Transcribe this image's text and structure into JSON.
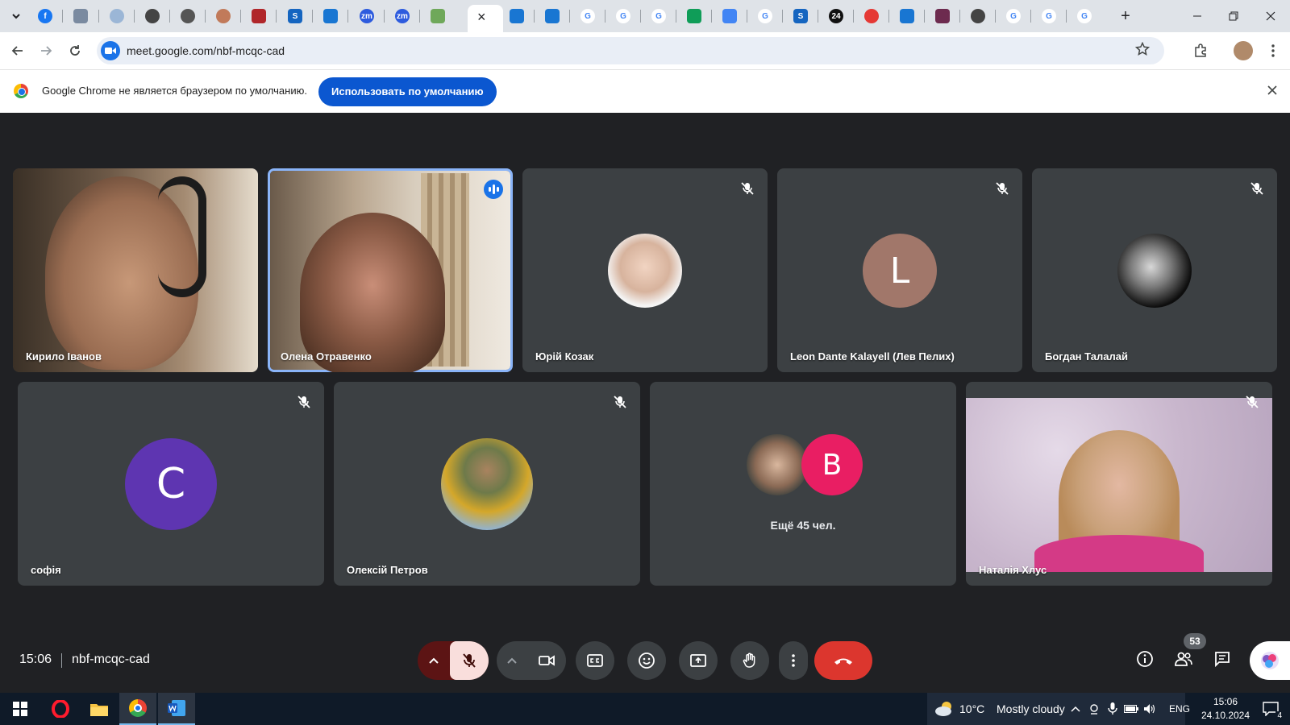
{
  "browser": {
    "url": "meet.google.com/nbf-mcqc-cad",
    "tab_close_glyph": "×",
    "new_tab_glyph": "+"
  },
  "infobar": {
    "message": "Google Chrome не является браузером по умолчанию.",
    "button_label": "Использовать по умолчанию"
  },
  "participants": [
    {
      "name": "Кирило Іванов",
      "type": "video",
      "muted": false
    },
    {
      "name": "Олена Отравенко",
      "type": "video",
      "speaking": true
    },
    {
      "name": "Юрій Козак",
      "type": "photo",
      "muted": true
    },
    {
      "name": "Leon Dante Kalayell (Лев Пелих)",
      "type": "initial",
      "initial": "L",
      "color": "#a1776a",
      "muted": true
    },
    {
      "name": "Богдан Талалай",
      "type": "photo",
      "muted": true
    },
    {
      "name": "софія",
      "type": "initial",
      "initial": "С",
      "color": "#5e35b1",
      "muted": true
    },
    {
      "name": "Олексій Петров",
      "type": "photo",
      "muted": true
    },
    {
      "name": "Наталія Хлус",
      "type": "video",
      "muted": true
    }
  ],
  "overflow_tile": {
    "initial": "B",
    "color": "#e91e63",
    "label": "Ещё 45 чел."
  },
  "meeting": {
    "time": "15:06",
    "code": "nbf-mcqc-cad",
    "participant_count": "53"
  },
  "colors": {
    "background": "#202124",
    "tile": "#3c4043",
    "hangup": "#dc362e",
    "mic_off": "#f9dedc",
    "accent": "#1a73e8"
  },
  "taskbar": {
    "weather_temp": "10°C",
    "weather_text": "Mostly cloudy",
    "language": "ENG",
    "clock_time": "15:06",
    "clock_date": "24.10.2024",
    "notification_count": "4"
  }
}
